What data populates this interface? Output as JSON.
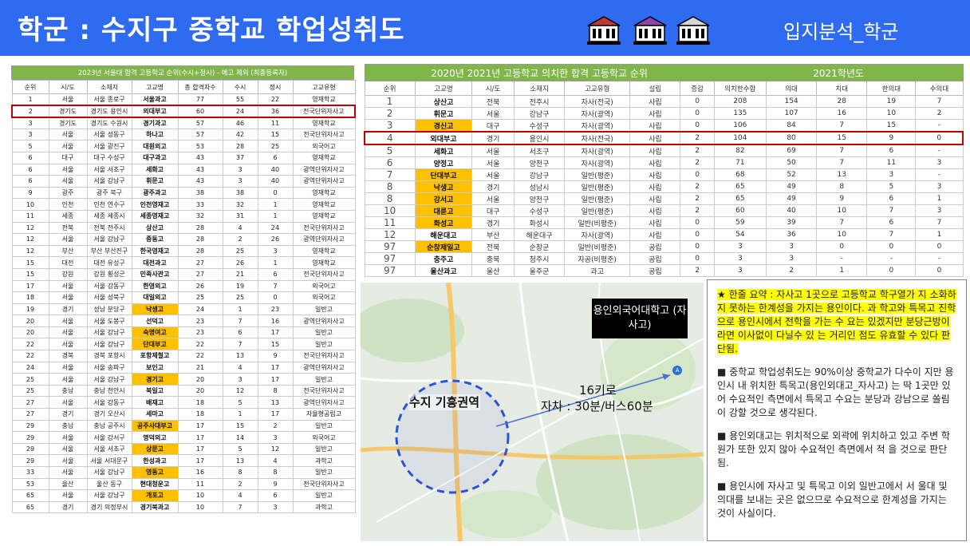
{
  "header": {
    "title": "학군 : 수지구 중학교 학업성취도",
    "right_label": "입지분석_학군"
  },
  "left_table": {
    "title": "2023년 서울대 합격 고등학교 순위(수시+정시) - 예고 제외 (최종등록자)",
    "columns": [
      "순위",
      "시/도",
      "소재지",
      "고교명",
      "총 합격자수",
      "수시",
      "정시",
      "고교유형"
    ],
    "rows": [
      {
        "cells": [
          "1",
          "서울",
          "서울 종로구",
          "서울과고",
          "77",
          "55",
          "22",
          "영재학교"
        ]
      },
      {
        "cells": [
          "2",
          "경기도",
          "경기도 용인시",
          "외대부고",
          "60",
          "24",
          "36",
          "전국단위자사고"
        ],
        "highlight_row": true
      },
      {
        "cells": [
          "3",
          "경기도",
          "경기도 수원시",
          "경기과고",
          "57",
          "46",
          "11",
          "영재학교"
        ]
      },
      {
        "cells": [
          "3",
          "서울",
          "서울 성동구",
          "하나고",
          "57",
          "42",
          "15",
          "전국단위자사고"
        ]
      },
      {
        "cells": [
          "5",
          "서울",
          "서울 광진구",
          "대원외고",
          "53",
          "28",
          "25",
          "외국어고"
        ]
      },
      {
        "cells": [
          "6",
          "대구",
          "대구 수성구",
          "대구과고",
          "43",
          "37",
          "6",
          "영재학교"
        ]
      },
      {
        "cells": [
          "6",
          "서울",
          "서울 서초구",
          "세화고",
          "43",
          "3",
          "40",
          "광역단위자사고"
        ]
      },
      {
        "cells": [
          "6",
          "서울",
          "서울 강남구",
          "휘문고",
          "43",
          "3",
          "40",
          "광역단위자사고"
        ]
      },
      {
        "cells": [
          "9",
          "광주",
          "광주 북구",
          "광주과고",
          "38",
          "38",
          "0",
          "영재학교"
        ]
      },
      {
        "cells": [
          "10",
          "인천",
          "인천 연수구",
          "인천영재고",
          "33",
          "32",
          "1",
          "영재학교"
        ]
      },
      {
        "cells": [
          "11",
          "세종",
          "세종 세종시",
          "세종영재고",
          "32",
          "31",
          "1",
          "영재학교"
        ]
      },
      {
        "cells": [
          "12",
          "전북",
          "전북 전주시",
          "상산고",
          "28",
          "4",
          "24",
          "전국단위자사고"
        ]
      },
      {
        "cells": [
          "12",
          "서울",
          "서울 강남구",
          "중동고",
          "28",
          "2",
          "26",
          "광역단위자사고"
        ]
      },
      {
        "cells": [
          "12",
          "부산",
          "부산 부산진구",
          "한국영재고",
          "28",
          "25",
          "3",
          "영재학교"
        ]
      },
      {
        "cells": [
          "15",
          "대전",
          "대전 유성구",
          "대전과고",
          "27",
          "26",
          "1",
          "영재학교"
        ]
      },
      {
        "cells": [
          "15",
          "강원",
          "강원 횡성군",
          "민족사관고",
          "27",
          "21",
          "6",
          "전국단위자사고"
        ]
      },
      {
        "cells": [
          "17",
          "서울",
          "서울 강동구",
          "한영외고",
          "26",
          "19",
          "7",
          "외국어고"
        ]
      },
      {
        "cells": [
          "18",
          "서울",
          "서울 성북구",
          "대일외고",
          "25",
          "25",
          "0",
          "외국어고"
        ]
      },
      {
        "cells": [
          "19",
          "경기",
          "성남 분당구",
          "낙생고",
          "24",
          "1",
          "23",
          "일반고"
        ],
        "hl_name": true
      },
      {
        "cells": [
          "20",
          "서울",
          "서울 도봉구",
          "선덕고",
          "23",
          "7",
          "16",
          "광역단위자사고"
        ]
      },
      {
        "cells": [
          "20",
          "서울",
          "서울 강남구",
          "숙명여고",
          "23",
          "6",
          "17",
          "일반고"
        ],
        "hl_name": true
      },
      {
        "cells": [
          "22",
          "서울",
          "서울 강남구",
          "단대부고",
          "22",
          "7",
          "15",
          "일반고"
        ],
        "hl_name": true
      },
      {
        "cells": [
          "22",
          "경북",
          "경북 포항시",
          "포항제철고",
          "22",
          "13",
          "9",
          "전국단위자사고"
        ]
      },
      {
        "cells": [
          "24",
          "서울",
          "서울 송파구",
          "보인고",
          "21",
          "4",
          "17",
          "광역단위자사고"
        ]
      },
      {
        "cells": [
          "25",
          "서울",
          "서울 강남구",
          "경기고",
          "20",
          "3",
          "17",
          "일반고"
        ],
        "hl_name": true
      },
      {
        "cells": [
          "25",
          "충남",
          "충남 천안시",
          "북일고",
          "20",
          "12",
          "8",
          "전국단위자사고"
        ]
      },
      {
        "cells": [
          "27",
          "서울",
          "서울 강동구",
          "배재고",
          "18",
          "5",
          "13",
          "광역단위자사고"
        ]
      },
      {
        "cells": [
          "27",
          "경기",
          "경기 오산시",
          "세마고",
          "18",
          "1",
          "17",
          "자율형공립고"
        ]
      },
      {
        "cells": [
          "29",
          "충남",
          "충남 공주시",
          "공주사대부고",
          "17",
          "15",
          "2",
          "일반고"
        ],
        "hl_name": true
      },
      {
        "cells": [
          "29",
          "서울",
          "서울 강서구",
          "명덕외고",
          "17",
          "14",
          "3",
          "외국어고"
        ]
      },
      {
        "cells": [
          "29",
          "서울",
          "서울 서초구",
          "상문고",
          "17",
          "5",
          "12",
          "일반고"
        ],
        "hl_name": true
      },
      {
        "cells": [
          "29",
          "서울",
          "서울 서대문구",
          "한성과고",
          "17",
          "13",
          "4",
          "과학고"
        ]
      },
      {
        "cells": [
          "33",
          "서울",
          "서울 강남구",
          "영동고",
          "16",
          "8",
          "8",
          "일반고"
        ],
        "hl_name": true
      },
      {
        "cells": [
          "53",
          "울산",
          "울산 동구",
          "현대청운고",
          "11",
          "2",
          "9",
          "전국단위자사고"
        ]
      },
      {
        "cells": [
          "65",
          "서울",
          "서울 강남구",
          "개포고",
          "10",
          "4",
          "6",
          "일반고"
        ],
        "hl_name": true
      },
      {
        "cells": [
          "65",
          "경기",
          "경기 의정부시",
          "경기북과고",
          "10",
          "7",
          "3",
          "과학고"
        ]
      }
    ]
  },
  "right_table": {
    "group_left": "2020년 2021년 고등학교 의치한 합격 고등학교 순위",
    "group_right": "2021학년도",
    "columns": [
      "순위",
      "고교명",
      "시/도",
      "소재지",
      "고교유형",
      "설립",
      "증감",
      "의치한수합",
      "의대",
      "치대",
      "한의대",
      "수의대"
    ],
    "rows": [
      {
        "cells": [
          "1",
          "상산고",
          "전북",
          "전주시",
          "자사(전국)",
          "사립",
          "0",
          "208",
          "154",
          "28",
          "19",
          "7"
        ]
      },
      {
        "cells": [
          "2",
          "휘문고",
          "서울",
          "강남구",
          "자사(광역)",
          "사립",
          "0",
          "135",
          "107",
          "16",
          "10",
          "2"
        ]
      },
      {
        "cells": [
          "3",
          "경신고",
          "대구",
          "수성구",
          "자사(광역)",
          "사립",
          "0",
          "106",
          "84",
          "7",
          "15",
          "-"
        ],
        "hl_name": true
      },
      {
        "cells": [
          "4",
          "외대부고",
          "경기",
          "용인시",
          "자사(전국)",
          "사립",
          "2",
          "104",
          "80",
          "15",
          "9",
          "0"
        ],
        "highlight_row": true
      },
      {
        "cells": [
          "5",
          "세화고",
          "서울",
          "서초구",
          "자사(광역)",
          "사립",
          "2",
          "82",
          "69",
          "7",
          "6",
          "-"
        ]
      },
      {
        "cells": [
          "6",
          "양정고",
          "서울",
          "양천구",
          "자사(광역)",
          "사립",
          "2",
          "71",
          "50",
          "7",
          "11",
          "3"
        ]
      },
      {
        "cells": [
          "7",
          "단대부고",
          "서울",
          "강남구",
          "일반(평준)",
          "사립",
          "0",
          "68",
          "52",
          "13",
          "3",
          "-"
        ],
        "hl_name": true
      },
      {
        "cells": [
          "8",
          "낙생고",
          "경기",
          "성남시",
          "일반(평준)",
          "사립",
          "2",
          "65",
          "49",
          "8",
          "5",
          "3"
        ],
        "hl_name": true
      },
      {
        "cells": [
          "8",
          "강서고",
          "서울",
          "양천구",
          "일반(평준)",
          "사립",
          "2",
          "65",
          "49",
          "9",
          "6",
          "1"
        ],
        "hl_name": true
      },
      {
        "cells": [
          "10",
          "대륜고",
          "대구",
          "수성구",
          "일반(평준)",
          "사립",
          "2",
          "60",
          "40",
          "10",
          "7",
          "3"
        ],
        "hl_name": true
      },
      {
        "cells": [
          "11",
          "화성고",
          "경기",
          "화성시",
          "일반(비평준)",
          "사립",
          "0",
          "59",
          "39",
          "7",
          "6",
          "7"
        ],
        "hl_name": true
      },
      {
        "cells": [
          "12",
          "해운대고",
          "부산",
          "해운대구",
          "자사(광역)",
          "사립",
          "0",
          "54",
          "36",
          "10",
          "7",
          "1"
        ]
      },
      {
        "cells": [
          "97",
          "순창제일고",
          "전북",
          "순창군",
          "일반(비평준)",
          "공립",
          "0",
          "3",
          "3",
          "0",
          "0",
          "0"
        ],
        "hl_name": true
      },
      {
        "cells": [
          "97",
          "충주고",
          "충북",
          "청주시",
          "자공(비평준)",
          "공립",
          "0",
          "3",
          "3",
          "-",
          "-",
          "-"
        ]
      },
      {
        "cells": [
          "97",
          "울산과고",
          "울산",
          "울주군",
          "과고",
          "공립",
          "2",
          "3",
          "2",
          "1",
          "0",
          "0"
        ]
      }
    ]
  },
  "map": {
    "callout": "용인외국어대학고 (자사고)",
    "route_line1": "16키로",
    "route_line2": "자차 : 30분/버스60분",
    "area_label": "수지 기흥권역"
  },
  "summary": {
    "para1": "★ 한줄 요약 : 자사고 1곳으로 고등학교 학구열가 지 소화하지 못하는 한계성을 가지는 용인이다. 과 학고와 특목고 진학으로 용인시에서 전학을 가는 수 요는 있겠지만 분당근방이라면 이사없이 다닐수 있 는 거리인 점도 유효할 수 있다 판단됨.",
    "para2": "■ 중학교 학업성취도는 90%이상 중학교가 다수이 지만 용인시 내 위치한 특목고(용인외대고_자사고) 는 딱 1곳만 있어 수요적인 측면에서 특목고 수요는 분당과 강남으로 쏠림이 강할 것으로 생각된다.",
    "para3": "■ 용인외대고는 위치적으로 외곽에 위치하고 있고 주변 학원가 또한 있지 않아 수요적인 측면에서 적 을 것으로 판단됨.",
    "para4": "■ 용인시에 자사고 및 특목고  이외 일반고에서 서 울대 및 의대를 보내는 곳은 없으므로 수요적으로 한계성을 가지는 것이 사실이다."
  },
  "colors": {
    "header_bg": "#2f6bf0",
    "table_header_green": "#80b54a",
    "highlight_orange": "#ffc000",
    "highlight_red": "#c00000",
    "summary_highlight": "#ffff00"
  }
}
